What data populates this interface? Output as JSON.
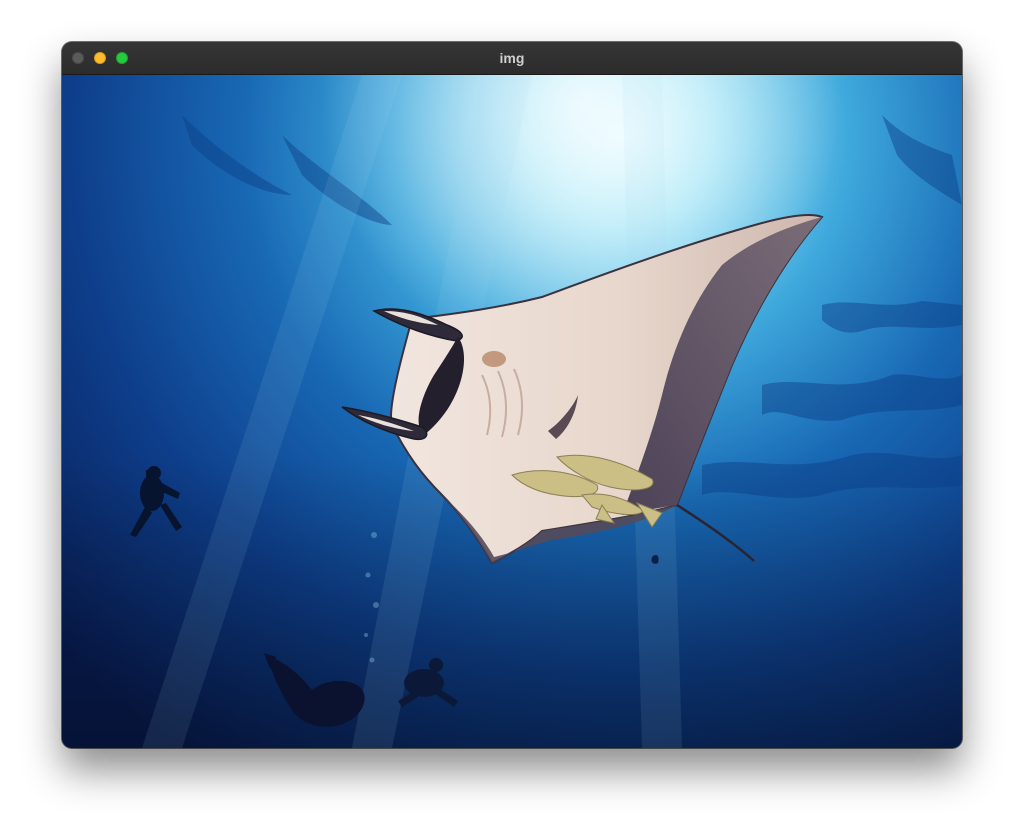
{
  "window": {
    "title": "img",
    "controls": [
      "close-icon",
      "minimize-icon",
      "zoom-icon"
    ],
    "control_colors": {
      "close": "#5b5b5b",
      "minimize": "#febc2e",
      "zoom": "#28c840"
    }
  },
  "image": {
    "subject": "manta-ray",
    "colors": {
      "water_deep": "#0a1f5c",
      "water_light": "#bff0ff",
      "manta_belly": "#e9dcd3",
      "manta_dark": "#5a4e5e",
      "remora": "#c9c08a"
    }
  }
}
